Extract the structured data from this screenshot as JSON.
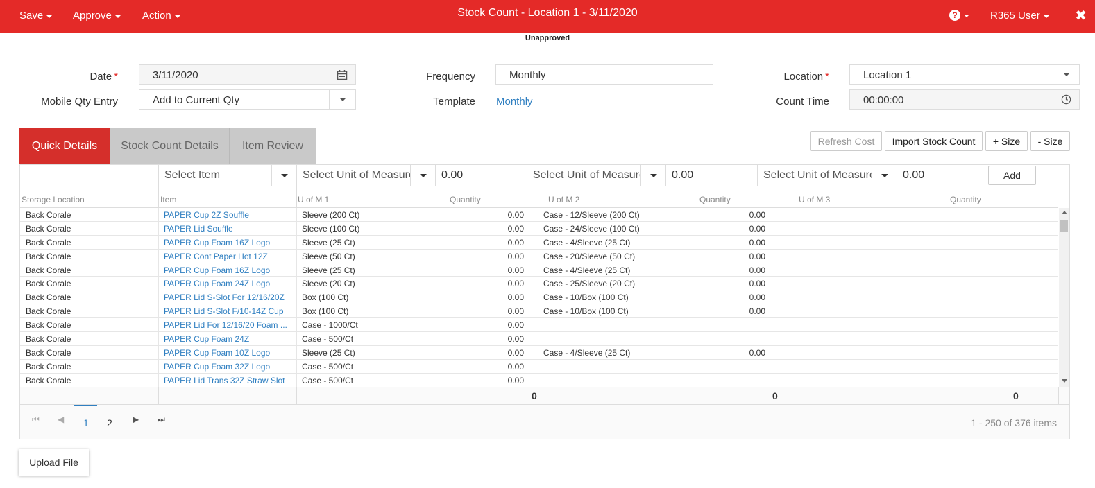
{
  "topbar": {
    "menus": [
      "Save",
      "Approve",
      "Action"
    ],
    "title": "Stock Count - Location 1 - 3/11/2020",
    "help_icon": "question-circle-icon",
    "user": "R365 User",
    "close": "✖",
    "brand_color": "#e42a28"
  },
  "status": "Unapproved",
  "form": {
    "date_label": "Date",
    "date_value": "3/11/2020",
    "mobile_label": "Mobile Qty Entry",
    "mobile_value": "Add to Current Qty",
    "frequency_label": "Frequency",
    "frequency_value": "Monthly",
    "template_label": "Template",
    "template_value": "Monthly",
    "location_label": "Location",
    "location_value": "Location 1",
    "count_time_label": "Count Time",
    "count_time_value": "00:00:00"
  },
  "tabs": [
    "Quick Details",
    "Stock Count Details",
    "Item Review"
  ],
  "buttons": {
    "refresh_cost": "Refresh Cost",
    "import": "Import Stock Count",
    "plus_size": "+ Size",
    "minus_size": "- Size"
  },
  "add_row": {
    "item_placeholder": "Select Item",
    "uom1_placeholder": "Select Unit of Measure",
    "qty1": "0.00",
    "uom2_placeholder": "Select Unit of Measure",
    "qty2": "0.00",
    "uom3_placeholder": "Select Unit of Measure",
    "qty3": "0.00",
    "add": "Add"
  },
  "columns": [
    "Storage Location",
    "Item",
    "U of M 1",
    "Quantity",
    "U of M 2",
    "Quantity",
    "U of M 3",
    "Quantity"
  ],
  "rows": [
    {
      "loc": "Back Corale",
      "item": "PAPER Cup 2Z Souffle",
      "uom1": "Sleeve (200 Ct)",
      "q1": "0.00",
      "uom2": "Case - 12/Sleeve (200 Ct)",
      "q2": "0.00"
    },
    {
      "loc": "Back Corale",
      "item": "PAPER Lid Souffle",
      "uom1": "Sleeve (100 Ct)",
      "q1": "0.00",
      "uom2": "Case - 24/Sleeve (100 Ct)",
      "q2": "0.00"
    },
    {
      "loc": "Back Corale",
      "item": "PAPER Cup Foam 16Z Logo",
      "uom1": "Sleeve (25 Ct)",
      "q1": "0.00",
      "uom2": "Case - 4/Sleeve (25 Ct)",
      "q2": "0.00"
    },
    {
      "loc": "Back Corale",
      "item": "PAPER Cont Paper Hot 12Z",
      "uom1": "Sleeve (50 Ct)",
      "q1": "0.00",
      "uom2": "Case - 20/Sleeve (50 Ct)",
      "q2": "0.00"
    },
    {
      "loc": "Back Corale",
      "item": "PAPER Cup Foam 16Z Logo",
      "uom1": "Sleeve (25 Ct)",
      "q1": "0.00",
      "uom2": "Case - 4/Sleeve (25 Ct)",
      "q2": "0.00"
    },
    {
      "loc": "Back Corale",
      "item": "PAPER Cup Foam 24Z Logo",
      "uom1": "Sleeve (20 Ct)",
      "q1": "0.00",
      "uom2": "Case - 25/Sleeve (20 Ct)",
      "q2": "0.00"
    },
    {
      "loc": "Back Corale",
      "item": "PAPER Lid S-Slot For 12/16/20Z",
      "uom1": "Box (100 Ct)",
      "q1": "0.00",
      "uom2": "Case - 10/Box (100 Ct)",
      "q2": "0.00"
    },
    {
      "loc": "Back Corale",
      "item": "PAPER Lid S-Slot F/10-14Z Cup",
      "uom1": "Box (100 Ct)",
      "q1": "0.00",
      "uom2": "Case - 10/Box (100 Ct)",
      "q2": "0.00"
    },
    {
      "loc": "Back Corale",
      "item": "PAPER Lid For 12/16/20 Foam ...",
      "uom1": "Case - 1000/Ct",
      "q1": "0.00",
      "uom2": "",
      "q2": ""
    },
    {
      "loc": "Back Corale",
      "item": "PAPER Cup Foam 24Z",
      "uom1": "Case - 500/Ct",
      "q1": "0.00",
      "uom2": "",
      "q2": ""
    },
    {
      "loc": "Back Corale",
      "item": "PAPER Cup Foam 10Z Logo",
      "uom1": "Sleeve (25 Ct)",
      "q1": "0.00",
      "uom2": "Case - 4/Sleeve (25 Ct)",
      "q2": "0.00"
    },
    {
      "loc": "Back Corale",
      "item": "PAPER Cup Foam 32Z Logo",
      "uom1": "Case - 500/Ct",
      "q1": "0.00",
      "uom2": "",
      "q2": ""
    },
    {
      "loc": "Back Corale",
      "item": "PAPER Lid Trans 32Z Straw Slot",
      "uom1": "Case - 500/Ct",
      "q1": "0.00",
      "uom2": "",
      "q2": ""
    }
  ],
  "totals": [
    "0",
    "0",
    "0"
  ],
  "pager": {
    "pages": [
      "1",
      "2"
    ],
    "first": "⏮",
    "prev": "◀",
    "next": "▶",
    "last": "⏭",
    "info": "1 - 250 of 376 items"
  },
  "upload": "Upload File"
}
